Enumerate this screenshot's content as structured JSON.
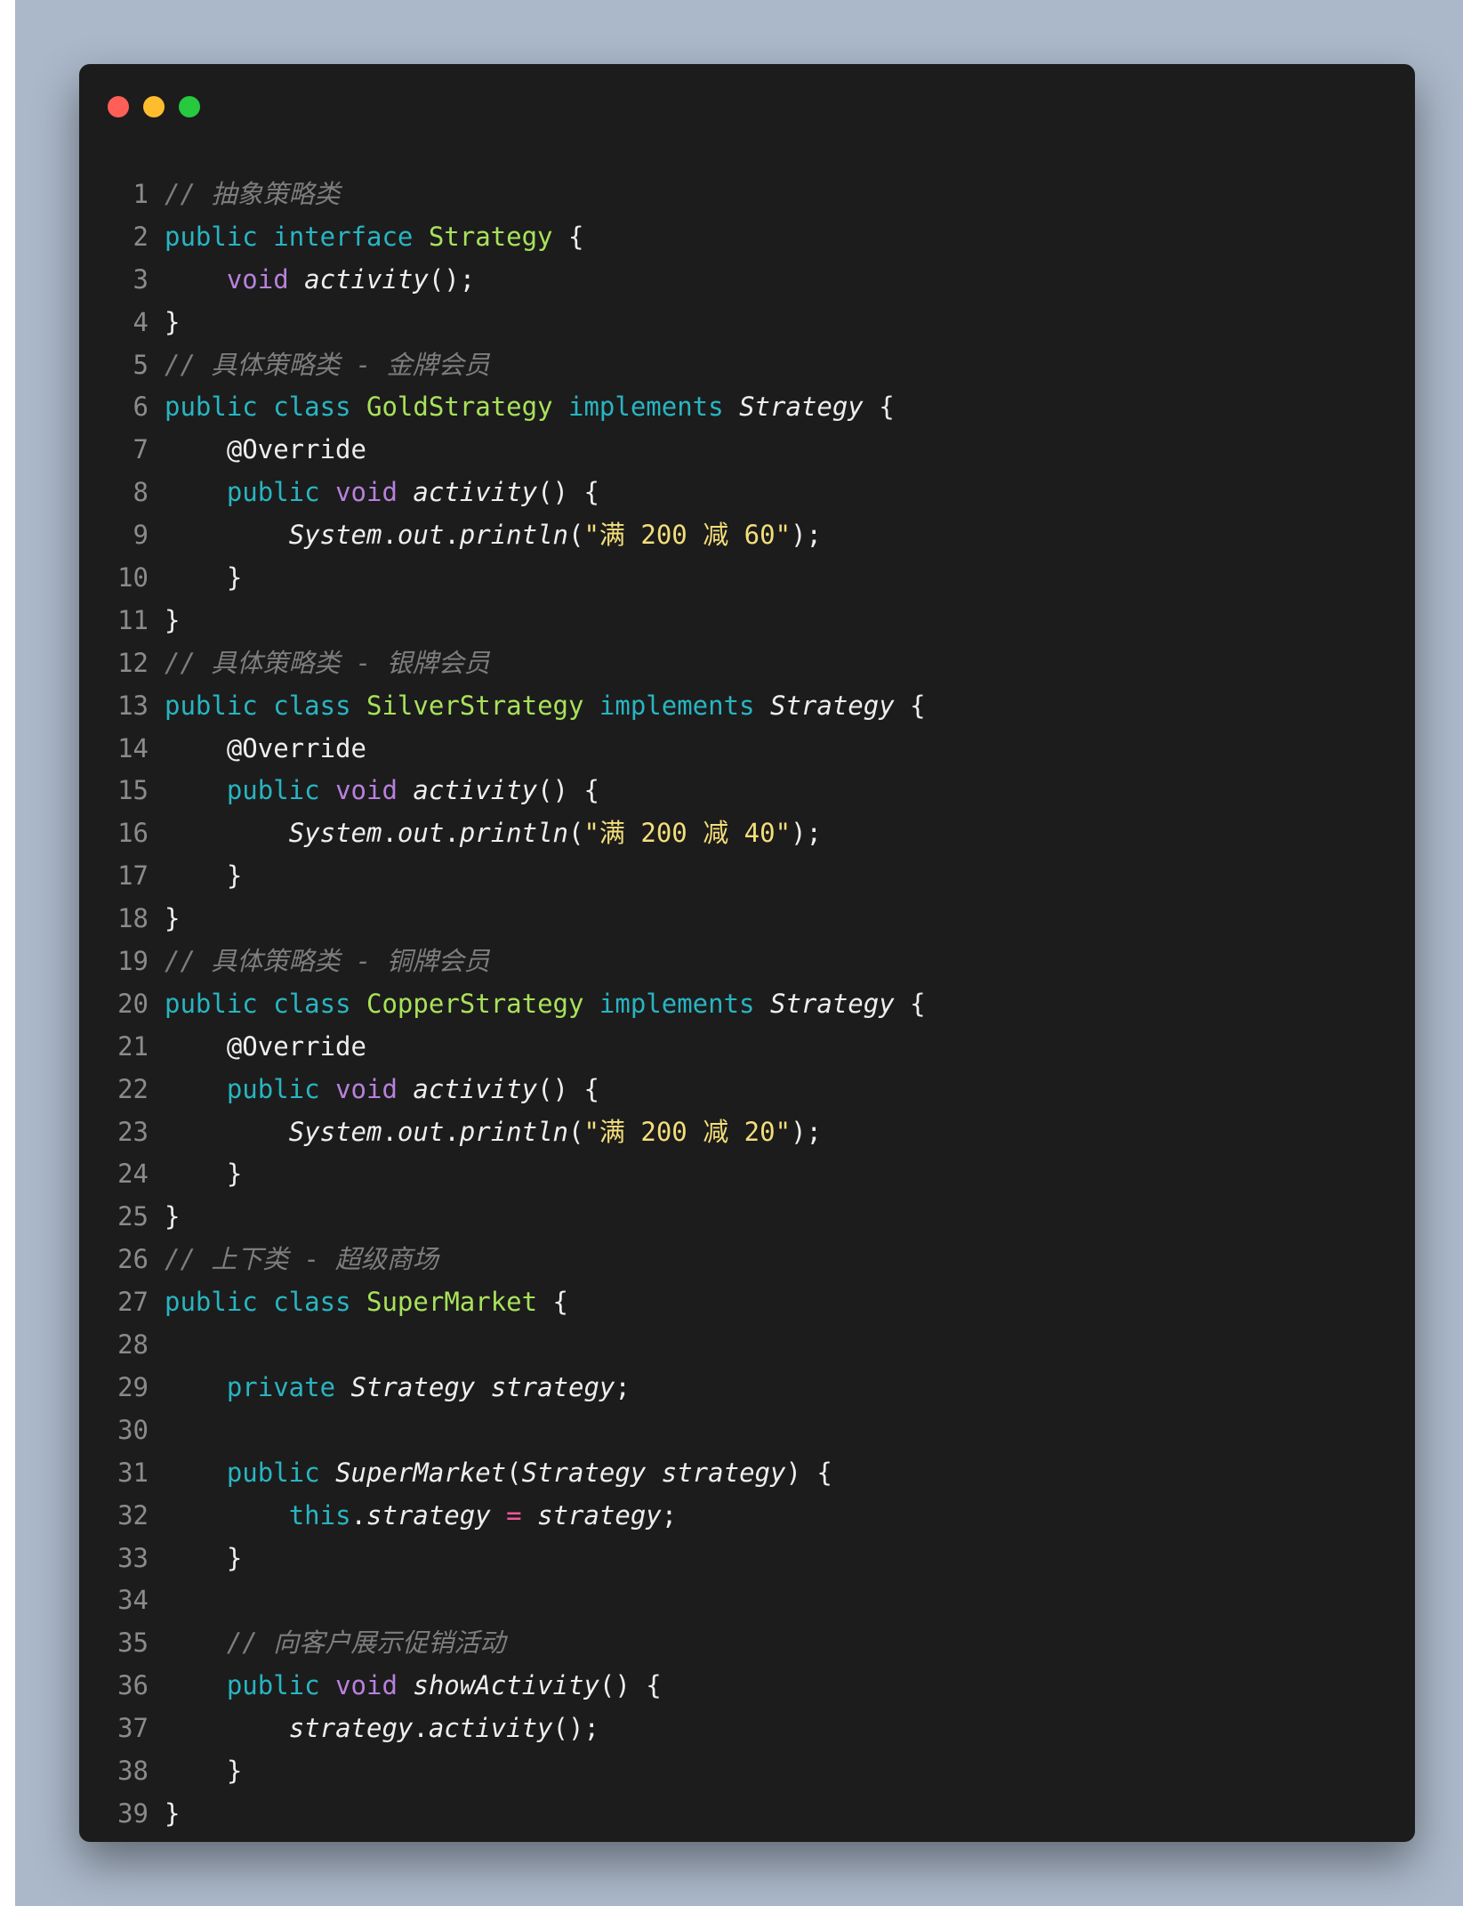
{
  "window": {
    "controls": [
      "close",
      "minimize",
      "maximize"
    ]
  },
  "code": [
    {
      "n": "1",
      "toks": [
        {
          "t": "// 抽象策略类",
          "c": "com"
        }
      ]
    },
    {
      "n": "2",
      "toks": [
        {
          "t": "public",
          "c": "kw"
        },
        {
          "t": " ",
          "c": "pl"
        },
        {
          "t": "interface",
          "c": "kw"
        },
        {
          "t": " ",
          "c": "pl"
        },
        {
          "t": "Strategy",
          "c": "cls"
        },
        {
          "t": " {",
          "c": "pl"
        }
      ]
    },
    {
      "n": "3",
      "toks": [
        {
          "t": "    ",
          "c": "pl"
        },
        {
          "t": "void",
          "c": "ty"
        },
        {
          "t": " ",
          "c": "pl"
        },
        {
          "t": "activity",
          "c": "it"
        },
        {
          "t": "();",
          "c": "pl"
        }
      ]
    },
    {
      "n": "4",
      "toks": [
        {
          "t": "}",
          "c": "pl"
        }
      ]
    },
    {
      "n": "5",
      "toks": [
        {
          "t": "// 具体策略类 - 金牌会员",
          "c": "com"
        }
      ]
    },
    {
      "n": "6",
      "toks": [
        {
          "t": "public",
          "c": "kw"
        },
        {
          "t": " ",
          "c": "pl"
        },
        {
          "t": "class",
          "c": "kw"
        },
        {
          "t": " ",
          "c": "pl"
        },
        {
          "t": "GoldStrategy",
          "c": "cls"
        },
        {
          "t": " ",
          "c": "pl"
        },
        {
          "t": "implements",
          "c": "kw"
        },
        {
          "t": " ",
          "c": "pl"
        },
        {
          "t": "Strategy",
          "c": "it"
        },
        {
          "t": " {",
          "c": "pl"
        }
      ]
    },
    {
      "n": "7",
      "toks": [
        {
          "t": "    ",
          "c": "pl"
        },
        {
          "t": "@Override",
          "c": "ann"
        }
      ]
    },
    {
      "n": "8",
      "toks": [
        {
          "t": "    ",
          "c": "pl"
        },
        {
          "t": "public",
          "c": "kw"
        },
        {
          "t": " ",
          "c": "pl"
        },
        {
          "t": "void",
          "c": "ty"
        },
        {
          "t": " ",
          "c": "pl"
        },
        {
          "t": "activity",
          "c": "it"
        },
        {
          "t": "() {",
          "c": "pl"
        }
      ]
    },
    {
      "n": "9",
      "toks": [
        {
          "t": "        ",
          "c": "pl"
        },
        {
          "t": "System",
          "c": "it"
        },
        {
          "t": ".",
          "c": "pl"
        },
        {
          "t": "out",
          "c": "it"
        },
        {
          "t": ".",
          "c": "pl"
        },
        {
          "t": "println",
          "c": "it"
        },
        {
          "t": "(",
          "c": "pl"
        },
        {
          "t": "\"满 200 减 60\"",
          "c": "str"
        },
        {
          "t": ");",
          "c": "pl"
        }
      ]
    },
    {
      "n": "10",
      "toks": [
        {
          "t": "    }",
          "c": "pl"
        }
      ]
    },
    {
      "n": "11",
      "toks": [
        {
          "t": "}",
          "c": "pl"
        }
      ]
    },
    {
      "n": "12",
      "toks": [
        {
          "t": "// 具体策略类 - 银牌会员",
          "c": "com"
        }
      ]
    },
    {
      "n": "13",
      "toks": [
        {
          "t": "public",
          "c": "kw"
        },
        {
          "t": " ",
          "c": "pl"
        },
        {
          "t": "class",
          "c": "kw"
        },
        {
          "t": " ",
          "c": "pl"
        },
        {
          "t": "SilverStrategy",
          "c": "cls"
        },
        {
          "t": " ",
          "c": "pl"
        },
        {
          "t": "implements",
          "c": "kw"
        },
        {
          "t": " ",
          "c": "pl"
        },
        {
          "t": "Strategy",
          "c": "it"
        },
        {
          "t": " {",
          "c": "pl"
        }
      ]
    },
    {
      "n": "14",
      "toks": [
        {
          "t": "    ",
          "c": "pl"
        },
        {
          "t": "@Override",
          "c": "ann"
        }
      ]
    },
    {
      "n": "15",
      "toks": [
        {
          "t": "    ",
          "c": "pl"
        },
        {
          "t": "public",
          "c": "kw"
        },
        {
          "t": " ",
          "c": "pl"
        },
        {
          "t": "void",
          "c": "ty"
        },
        {
          "t": " ",
          "c": "pl"
        },
        {
          "t": "activity",
          "c": "it"
        },
        {
          "t": "() {",
          "c": "pl"
        }
      ]
    },
    {
      "n": "16",
      "toks": [
        {
          "t": "        ",
          "c": "pl"
        },
        {
          "t": "System",
          "c": "it"
        },
        {
          "t": ".",
          "c": "pl"
        },
        {
          "t": "out",
          "c": "it"
        },
        {
          "t": ".",
          "c": "pl"
        },
        {
          "t": "println",
          "c": "it"
        },
        {
          "t": "(",
          "c": "pl"
        },
        {
          "t": "\"满 200 减 40\"",
          "c": "str"
        },
        {
          "t": ");",
          "c": "pl"
        }
      ]
    },
    {
      "n": "17",
      "toks": [
        {
          "t": "    }",
          "c": "pl"
        }
      ]
    },
    {
      "n": "18",
      "toks": [
        {
          "t": "}",
          "c": "pl"
        }
      ]
    },
    {
      "n": "19",
      "toks": [
        {
          "t": "// 具体策略类 - 铜牌会员",
          "c": "com"
        }
      ]
    },
    {
      "n": "20",
      "toks": [
        {
          "t": "public",
          "c": "kw"
        },
        {
          "t": " ",
          "c": "pl"
        },
        {
          "t": "class",
          "c": "kw"
        },
        {
          "t": " ",
          "c": "pl"
        },
        {
          "t": "CopperStrategy",
          "c": "cls"
        },
        {
          "t": " ",
          "c": "pl"
        },
        {
          "t": "implements",
          "c": "kw"
        },
        {
          "t": " ",
          "c": "pl"
        },
        {
          "t": "Strategy",
          "c": "it"
        },
        {
          "t": " {",
          "c": "pl"
        }
      ]
    },
    {
      "n": "21",
      "toks": [
        {
          "t": "    ",
          "c": "pl"
        },
        {
          "t": "@Override",
          "c": "ann"
        }
      ]
    },
    {
      "n": "22",
      "toks": [
        {
          "t": "    ",
          "c": "pl"
        },
        {
          "t": "public",
          "c": "kw"
        },
        {
          "t": " ",
          "c": "pl"
        },
        {
          "t": "void",
          "c": "ty"
        },
        {
          "t": " ",
          "c": "pl"
        },
        {
          "t": "activity",
          "c": "it"
        },
        {
          "t": "() {",
          "c": "pl"
        }
      ]
    },
    {
      "n": "23",
      "toks": [
        {
          "t": "        ",
          "c": "pl"
        },
        {
          "t": "System",
          "c": "it"
        },
        {
          "t": ".",
          "c": "pl"
        },
        {
          "t": "out",
          "c": "it"
        },
        {
          "t": ".",
          "c": "pl"
        },
        {
          "t": "println",
          "c": "it"
        },
        {
          "t": "(",
          "c": "pl"
        },
        {
          "t": "\"满 200 减 20\"",
          "c": "str"
        },
        {
          "t": ");",
          "c": "pl"
        }
      ]
    },
    {
      "n": "24",
      "toks": [
        {
          "t": "    }",
          "c": "pl"
        }
      ]
    },
    {
      "n": "25",
      "toks": [
        {
          "t": "}",
          "c": "pl"
        }
      ]
    },
    {
      "n": "26",
      "toks": [
        {
          "t": "// 上下类 - 超级商场",
          "c": "com"
        }
      ]
    },
    {
      "n": "27",
      "toks": [
        {
          "t": "public",
          "c": "kw"
        },
        {
          "t": " ",
          "c": "pl"
        },
        {
          "t": "class",
          "c": "kw"
        },
        {
          "t": " ",
          "c": "pl"
        },
        {
          "t": "SuperMarket",
          "c": "cls"
        },
        {
          "t": " {",
          "c": "pl"
        }
      ]
    },
    {
      "n": "28",
      "toks": []
    },
    {
      "n": "29",
      "toks": [
        {
          "t": "    ",
          "c": "pl"
        },
        {
          "t": "private",
          "c": "kw"
        },
        {
          "t": " ",
          "c": "pl"
        },
        {
          "t": "Strategy",
          "c": "it"
        },
        {
          "t": " ",
          "c": "pl"
        },
        {
          "t": "strategy",
          "c": "it"
        },
        {
          "t": ";",
          "c": "pl"
        }
      ]
    },
    {
      "n": "30",
      "toks": []
    },
    {
      "n": "31",
      "toks": [
        {
          "t": "    ",
          "c": "pl"
        },
        {
          "t": "public",
          "c": "kw"
        },
        {
          "t": " ",
          "c": "pl"
        },
        {
          "t": "SuperMarket",
          "c": "it"
        },
        {
          "t": "(",
          "c": "pl"
        },
        {
          "t": "Strategy",
          "c": "it"
        },
        {
          "t": " ",
          "c": "pl"
        },
        {
          "t": "strategy",
          "c": "it"
        },
        {
          "t": ") {",
          "c": "pl"
        }
      ]
    },
    {
      "n": "32",
      "toks": [
        {
          "t": "        ",
          "c": "pl"
        },
        {
          "t": "this",
          "c": "kw"
        },
        {
          "t": ".",
          "c": "pl"
        },
        {
          "t": "strategy",
          "c": "it"
        },
        {
          "t": " ",
          "c": "pl"
        },
        {
          "t": "=",
          "c": "op"
        },
        {
          "t": " ",
          "c": "pl"
        },
        {
          "t": "strategy",
          "c": "it"
        },
        {
          "t": ";",
          "c": "pl"
        }
      ]
    },
    {
      "n": "33",
      "toks": [
        {
          "t": "    }",
          "c": "pl"
        }
      ]
    },
    {
      "n": "34",
      "toks": []
    },
    {
      "n": "35",
      "toks": [
        {
          "t": "    ",
          "c": "pl"
        },
        {
          "t": "// 向客户展示促销活动",
          "c": "com"
        }
      ]
    },
    {
      "n": "36",
      "toks": [
        {
          "t": "    ",
          "c": "pl"
        },
        {
          "t": "public",
          "c": "kw"
        },
        {
          "t": " ",
          "c": "pl"
        },
        {
          "t": "void",
          "c": "ty"
        },
        {
          "t": " ",
          "c": "pl"
        },
        {
          "t": "showActivity",
          "c": "it"
        },
        {
          "t": "() {",
          "c": "pl"
        }
      ]
    },
    {
      "n": "37",
      "toks": [
        {
          "t": "        ",
          "c": "pl"
        },
        {
          "t": "strategy",
          "c": "it"
        },
        {
          "t": ".",
          "c": "pl"
        },
        {
          "t": "activity",
          "c": "it"
        },
        {
          "t": "();",
          "c": "pl"
        }
      ]
    },
    {
      "n": "38",
      "toks": [
        {
          "t": "    }",
          "c": "pl"
        }
      ]
    },
    {
      "n": "39",
      "toks": [
        {
          "t": "}",
          "c": "pl"
        }
      ]
    }
  ],
  "colors": {
    "keyword": "#28b5c2",
    "type": "#b881dd",
    "class": "#a8e25a",
    "string": "#f4de7a",
    "comment": "#7d7d7d",
    "operator": "#f0589a",
    "text": "#eeeeee"
  }
}
